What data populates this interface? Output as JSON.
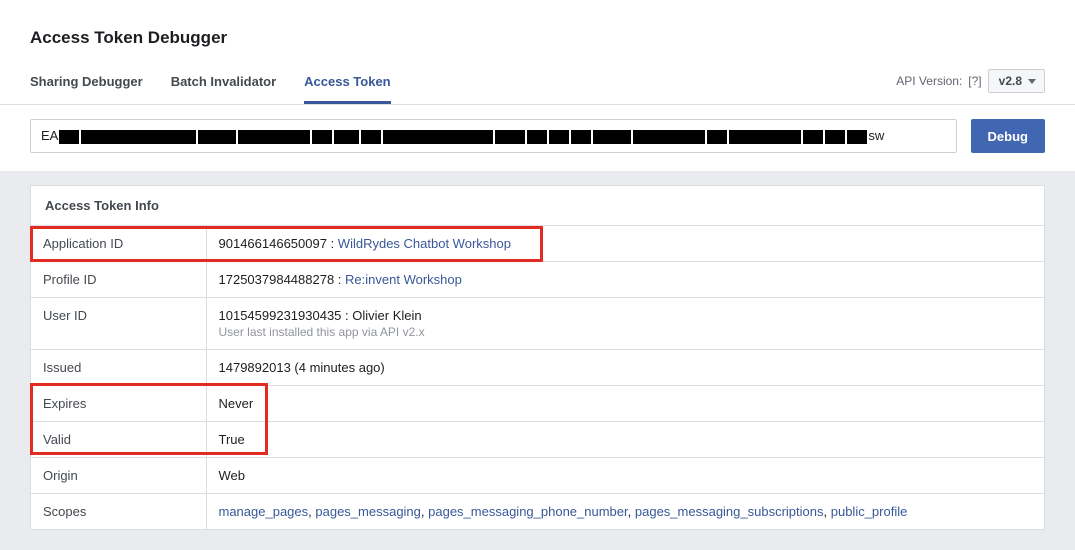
{
  "page_title": "Access Token Debugger",
  "tabs": {
    "sharing": "Sharing Debugger",
    "batch": "Batch Invalidator",
    "access": "Access Token"
  },
  "api_version": {
    "label": "API Version:",
    "help": "[?]",
    "value": "v2.8"
  },
  "token_field": {
    "prefix": "EA",
    "suffix": "sw"
  },
  "debug_label": "Debug",
  "card_title": "Access Token Info",
  "rows": {
    "app_id": {
      "k": "Application ID",
      "id": "901466146650097",
      "link": "WildRydes Chatbot Workshop"
    },
    "prof_id": {
      "k": "Profile ID",
      "id": "1725037984488278",
      "link": "Re:invent Workshop"
    },
    "user_id": {
      "k": "User ID",
      "id": "10154599231930435",
      "name": "Olivier Klein",
      "note": "User last installed this app via API v2.x"
    },
    "issued": {
      "k": "Issued",
      "v": "1479892013 (4 minutes ago)"
    },
    "expires": {
      "k": "Expires",
      "v": "Never"
    },
    "valid": {
      "k": "Valid",
      "v": "True"
    },
    "origin": {
      "k": "Origin",
      "v": "Web"
    },
    "scopes_label": "Scopes",
    "scopes": [
      "manage_pages",
      "pages_messaging",
      "pages_messaging_phone_number",
      "pages_messaging_subscriptions",
      "public_profile"
    ]
  }
}
